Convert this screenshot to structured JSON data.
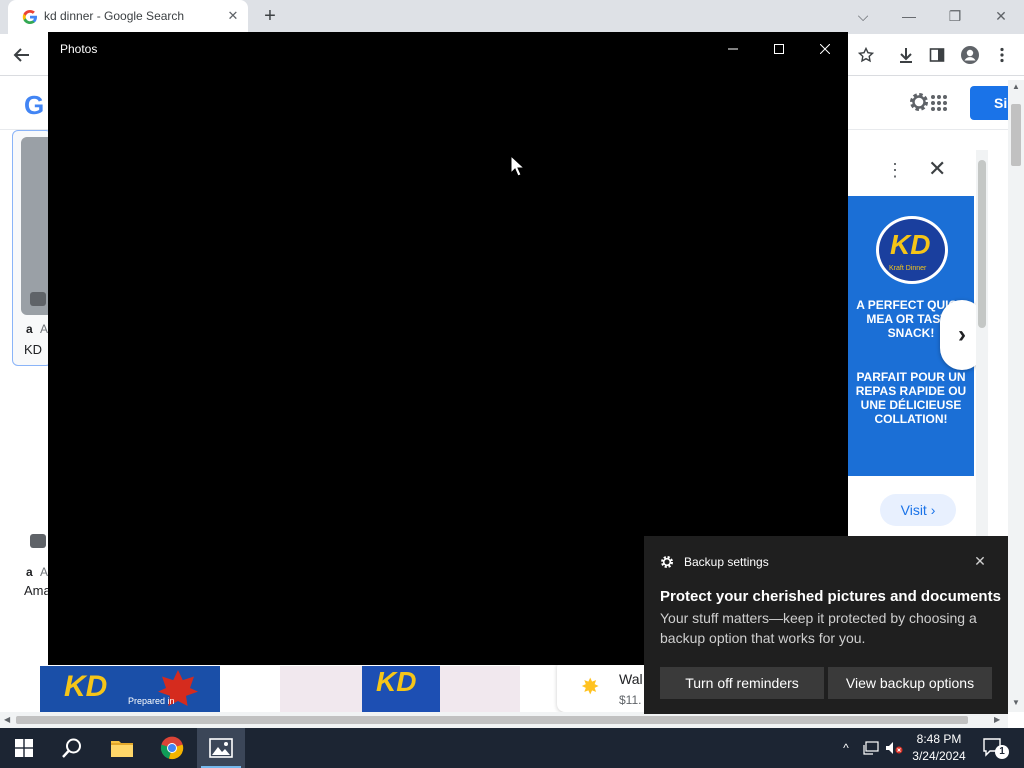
{
  "chrome": {
    "tab_title": "kd dinner - Google Search",
    "tab_close": "✕",
    "new_tab": "+",
    "window_controls": {
      "tab_search": "⌵",
      "minimize": "—",
      "restore": "❐",
      "close": "✕"
    },
    "toolbar_icons": [
      "back-arrow-icon",
      "star-icon",
      "download-icon",
      "side-panel-icon",
      "profile-icon",
      "more-menu-icon"
    ]
  },
  "page": {
    "logo_letter": "G",
    "signin_label": "Si",
    "left_cards": {
      "kd_text": "KD",
      "ama_text": "Ama",
      "amazon_mark_1": "a",
      "amazon_mark_2": "a",
      "amazon_text_1": "A",
      "amazon_text_2": "A"
    },
    "strip": {
      "kd_left": "KD",
      "prepared": "Prepared in",
      "kd_mid": "KD"
    },
    "walmart": {
      "name": "Wal",
      "price": "$11.",
      "star": "✸"
    },
    "ad": {
      "dots": "⋮",
      "close": "✕",
      "logo_text": "KD",
      "logo_sub": "Kraft Dinner",
      "english_text": "A PERFECT QUICK MEA OR TASTY SNACK!",
      "french_text": "PARFAIT POUR UN REPAS RAPIDE OU UNE DÉLICIEUSE COLLATION!",
      "next": "›",
      "visit_label": "Visit ›"
    }
  },
  "photos": {
    "title": "Photos",
    "controls": {
      "minimize": "—",
      "maximize": "☐",
      "close": "✕"
    }
  },
  "toast": {
    "app_name": "Backup settings",
    "close": "✕",
    "heading": "Protect your cherished pictures and documents",
    "body": "Your stuff matters—keep it protected by choosing a backup option that works for you.",
    "btn_turn_off": "Turn off reminders",
    "btn_view": "View backup options"
  },
  "taskbar": {
    "time": "8:48 PM",
    "date": "3/24/2024",
    "notification_count": "1",
    "tray_chevron": "^",
    "apps": [
      "start-icon",
      "search-icon",
      "file-explorer-icon",
      "chrome-icon",
      "photos-icon"
    ]
  }
}
